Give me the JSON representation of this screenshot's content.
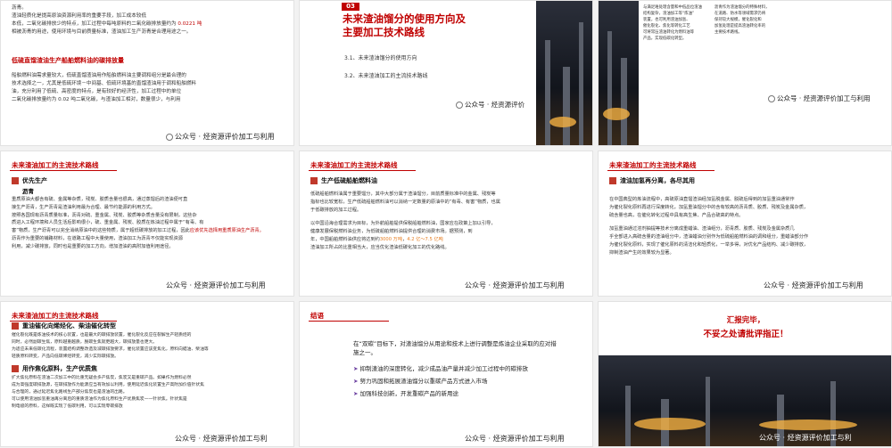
{
  "slide1": {
    "lines": [
      "沥青。",
      "渣油轻质化是提高原油资源利用率的重要手段，加工成本较低",
      "本低，二氧化碳排放少的特点，加工过程中每吨原料的二氧化碳排放量约为",
      "相被沥青的用途，使用环境与目前质量标准，渣油加工生产沥青是合理用途之一。"
    ],
    "co2_value": "0.0221 吨",
    "heading": "低硫直馏渣油生产船舶燃料油的碳排放量",
    "body": [
      "船舶燃料油需求量较大，低硫直馏渣油用作船舶燃料油主要调和组分是最合理的",
      "技术选择之一，尤其是低硫环境－中间基、低硫环境基的直馏渣油用于调和船舶燃料",
      "油，充分利用了低硫、高密度的特点，是有较好的经济性，加工过程中的单位",
      "二氧化碳排放量约为 0.02 吨二氧化碳，与渣油加工相对，数量很少，与利用"
    ],
    "watermark": "公众号 · 烃资源评价加工与利用"
  },
  "slide2": {
    "number": "03",
    "title_line1": "未来渣油馏分的使用方向及",
    "title_line2": "主要加工技术路线",
    "items": [
      "3.1、未来渣油馏分的使用方向",
      "3.2、未来渣油加工的主流技术路线"
    ],
    "watermark": "公众号 · 烃资源评价"
  },
  "slide3": {
    "col1": [
      "与满足难处理含量和中低品位渣油",
      "结构复杂，渣油加工等“炼油”",
      "装置，也可利用渣油加氢、",
      "催化裂化、焦化等转化工艺",
      "可将常压渣油转化为燃料油等",
      "产品，实现低碳化转型。"
    ],
    "col2": [
      "沥青作为渣油馏分的特殊材料，",
      "在道路、防水等领域需求仍将",
      "保持较大规模，催化裂化和",
      "加氢处理是提高渣油转化率的",
      "主要技术路线。"
    ],
    "watermark": "公众号 · 烃资源评价加工与利用"
  },
  "slide4": {
    "header": "未来渣油加工的主流技术路线",
    "section": "优先生产",
    "subsection": "沥青",
    "lines": [
      "重质原油大都含有硫、金属等杂质，残炭、胶质含量也很高，通过蒸馏后的渣油便可直",
      "接生产沥青，生产沥青是渣油利用最为合理、最节约能源的利用方式。",
      "按照各国现有沥青质量标准，沥青对硫、重金属、残炭、胶质等杂质含量没有限制，这些杂",
      "质进入工程环境和人员生活后影响很小，硫、重金属、残炭、胶质在炼油过程中属于“有毒、有",
      "害”物质，生产沥青可以完全消纳原油中的这些物质，属于超低碳排放的加工过程，因此"
    ],
    "highlight": "应该优先选择用重质原油生产沥青。",
    "lines2": [
      "沥青作为重要的铺路材料，在道路工程中大量使用，渣油加工为沥青不仅能实现资源",
      "利用，减少碳排放，同时也是重要的加工方向，增加渣油的高附加值利用途径。"
    ],
    "watermark": "公众号 · 烃资源评价加工与利用"
  },
  "slide5": {
    "header": "未来渣油加工的主流技术路线",
    "section": "生产低硫船舶燃料油",
    "lines": [
      "低硫船舶燃料油属于重要馏分，其中大部分属于渣油馏分，目前质量标准中的金属、残炭等",
      "指标也比较宽松，生产低硫船舶燃料油可以消纳一定数量的原油中的“有毒、有害”物质，也属",
      "于低碳排放的加工过程。",
      "以中国沿海合理需求为目标，为外航船舶提供保税船舶燃料油，国家应在政策上加以引导，",
      "健康发展保税燃料油业务，为低硫船舶燃料油提供合理的消费市场。据预测，到",
      "年，中国船舶燃料油供应将达到约"
    ],
    "highlight1": "3000 万吨",
    "highlight2": "4.2 亿～7.5 亿吨",
    "lines2": [
      "渣油加工所占的比重相当大，应当优化渣油低碳化加工的优化路线。"
    ],
    "watermark": "公众号 · 烃资源评价加工与利用"
  },
  "slide6": {
    "header": "未来渣油加工的主流技术路线",
    "section": "渣油加氢再分离，各尽其用",
    "lines": [
      "在中国典型的炼油流程中，高硫原油直馏渣油经加氢脱金属、脱硫后得到的加氢重油通常作",
      "为催化裂化原料再进行深度转化，加氢重油馏分中的含有较高的沥青质、胶质、残炭及金属杂质，",
      "硫含量也高，在催化转化过程中具有高生焦、产品合硫高的特点。",
      "加氢重油通过溶剂抽提等技术分离成重蜡油、渣油组分，沥青质、胶质、残炭及金属杂质几",
      "乎全部进入高硫含量的渣油组分中，渣油蜡油分别作为低硫船舶燃料油的调和组分，重蜡油部分作",
      "为催化裂化原料，实现了催化原料的清洁化和轻质化，一举多得，对优化产品结构、减少碳排放，",
      "抑制渣油产生的效果较为显著。"
    ],
    "watermark": "公众号 · 烃资源评价加工与利用"
  },
  "slide7": {
    "header": "未来渣油加工的主流技术路线",
    "section1": "重油催化向烯烃化、柴油催化转型",
    "lines1": [
      "催化裂化既是炼油技术的核心装置，也是最大的碳排放装置，催化裂化反应在裂解生产轻质烃的",
      "同时，必然副碳生焦，原料越重越质，脱碳生焦就更越大，碳排放量也更大。",
      "为适应未来低碳化流程，装置结构调整改造及减碳排放要求，催化装置应该变焦化，原料向蜡油、柴油等",
      "轻质原料转变，产品向低碳烯烃转变，减少实际碳排放。"
    ],
    "section2": "用作焦化原料，生产优质焦",
    "lines2": [
      "扩大焦化原料在渣油二次加工中的比重无疑会多产焦炭，焦炭又是重碳产品。如果作为燃料必然",
      "成为高强度碳排放源，在碳排放作为能源应当有效加以利用，使用延迟焦化装置生产高附加价值针状焦",
      "与合理的，通过延迟焦化路线生产部分焦炭也是渣油的出路。",
      "可以使用渣油加氢重油再分离后的重质渣油作为焦化原料生产优质焦炭——针状焦。针状焦是",
      "制电极的原料，这样既实现了低碳利用，可以实现零碳排放"
    ],
    "watermark": "公众号 · 烃资源评价加工与利"
  },
  "slide8": {
    "header": "结语",
    "intro": "在“双碳”目标下，对渣油馏分从用途和技术上进行调整是炼油企业采取的应对措施之一。",
    "bullets": [
      "抑制渣油的深度转化，减少成品油产量并减少加工过程中的碳排放",
      "努力巩固和拓展渣油馏分以重碳产品方式进入市场",
      "加强科技创新，开发重碳产品的新用途"
    ],
    "watermark": "公众号 · 烃资源评价加工与利用"
  },
  "slide9": {
    "line1": "汇报完毕，",
    "line2": "不妥之处请批评指正！",
    "watermark": "公众号 · 烃资源评价加工与利"
  },
  "colors": {
    "accent": "#c00000",
    "highlight": "#e67e22",
    "bullet": "#6b3fa0"
  }
}
